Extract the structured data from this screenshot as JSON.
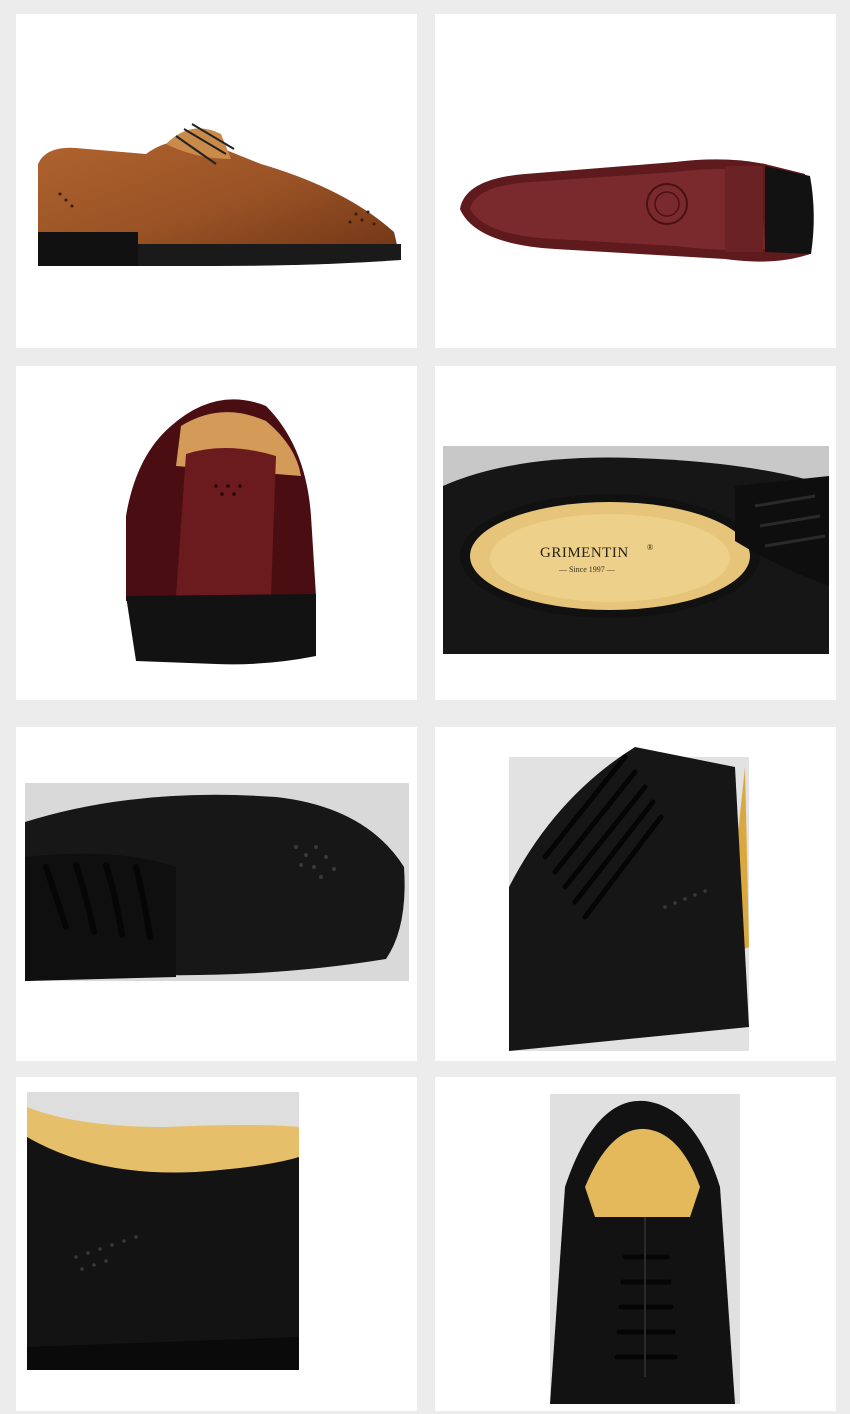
{
  "brand": {
    "name": "GRIMENTIN",
    "registered_mark": "®",
    "tagline": "— Since 1997 —"
  },
  "photos": [
    {
      "subject": "brown-brogue-oxford-side-view"
    },
    {
      "subject": "leather-sole-bottom-view"
    },
    {
      "subject": "burgundy-heel-back-view"
    },
    {
      "subject": "black-oxford-insole-view"
    },
    {
      "subject": "black-toe-brogue-closeup"
    },
    {
      "subject": "black-lacing-closeup"
    },
    {
      "subject": "black-heel-collar-closeup"
    },
    {
      "subject": "black-front-lacing-view"
    }
  ],
  "colors": {
    "page_background": "#ececec",
    "tile_background": "#ffffff",
    "tan_leather": "#8b4a22",
    "burgundy_leather": "#5a1416",
    "black_leather": "#141414",
    "insole_yellow": "#e9c878"
  }
}
